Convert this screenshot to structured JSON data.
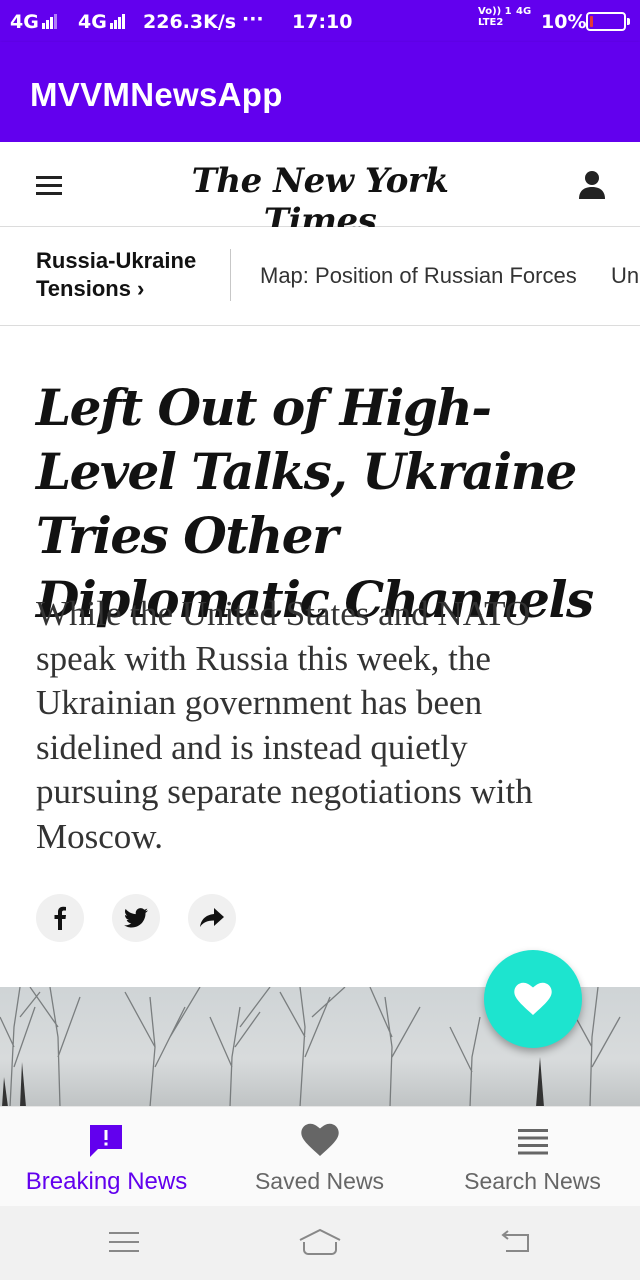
{
  "status_bar": {
    "network1": "4G",
    "network2": "4G",
    "speed": "226.3K/s",
    "dots": "···",
    "time": "17:10",
    "volte_label": "Vo)) 1",
    "lte_label": "LTE2",
    "network3": "4G",
    "battery": "10%",
    "battery_level": 0.1,
    "battery_color": "#e53935"
  },
  "app_bar": {
    "title": "MVVMNewsApp",
    "color": "#6200ee"
  },
  "nyt_header": {
    "logo_text": "The New York Times"
  },
  "subnav": {
    "primary": "Russia-Ukraine Tensions ›",
    "links": [
      "Map: Position of Russian Forces",
      "Un"
    ]
  },
  "article": {
    "headline": "Left Out of High-Level Talks, Ukraine Tries Other Diplomatic Channels",
    "summary": "While the United States and NATO speak with Russia this week, the Ukrainian government has been sidelined and is instead quietly pursuing separate negotiations with Moscow."
  },
  "share": {
    "icons": [
      "facebook-icon",
      "twitter-icon",
      "share-arrow-icon"
    ]
  },
  "fab": {
    "icon": "heart-icon",
    "color": "#1de4cf"
  },
  "bottom_nav": {
    "items": [
      {
        "label": "Breaking News",
        "icon": "breaking-news-icon",
        "active": true
      },
      {
        "label": "Saved News",
        "icon": "heart-icon",
        "active": false
      },
      {
        "label": "Search News",
        "icon": "list-icon",
        "active": false
      }
    ],
    "active_color": "#6200ee"
  },
  "system_nav": {
    "buttons": [
      "menu-icon",
      "home-icon",
      "back-icon"
    ]
  }
}
